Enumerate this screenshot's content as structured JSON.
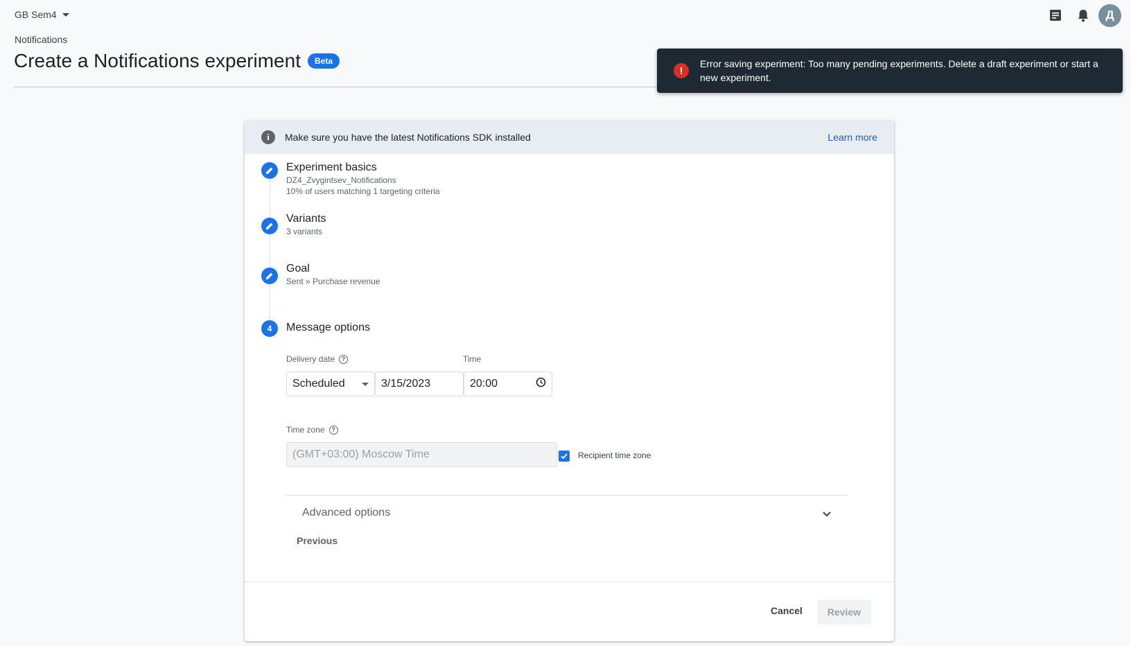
{
  "header": {
    "project": "GB Sem4",
    "avatar_letter": "Д",
    "icons": [
      "release-notes-icon",
      "bell-icon"
    ]
  },
  "page": {
    "breadcrumb": "Notifications",
    "title": "Create a Notifications experiment",
    "badge": "Beta"
  },
  "toast": {
    "message": "Error saving experiment: Too many pending experiments. Delete a draft experiment or start a new experiment.",
    "icon": "!"
  },
  "info": {
    "icon": "i",
    "text": "Make sure you have the latest Notifications SDK installed",
    "link": "Learn more"
  },
  "steps": [
    {
      "title": "Experiment basics",
      "sub1": "DZ4_Zvygintsev_Notifications",
      "sub2": "10% of users matching 1 targeting criteria"
    },
    {
      "title": "Variants",
      "sub1": "3 variants"
    },
    {
      "title": "Goal",
      "sub1": "Sent » Purchase revenue"
    },
    {
      "title": "Message options",
      "number": "4"
    }
  ],
  "form": {
    "delivery_label": "Delivery date",
    "time_label": "Time",
    "delivery_type": "Scheduled",
    "date": "3/15/2023",
    "time": "20:00",
    "timezone_label": "Time zone",
    "timezone_value": "(GMT+03:00) Moscow Time",
    "recipient_tz_label": "Recipient time zone",
    "recipient_tz_checked": true,
    "advanced": "Advanced options",
    "help_glyph": "?"
  },
  "footer": {
    "previous": "Previous",
    "cancel": "Cancel",
    "review": "Review"
  }
}
